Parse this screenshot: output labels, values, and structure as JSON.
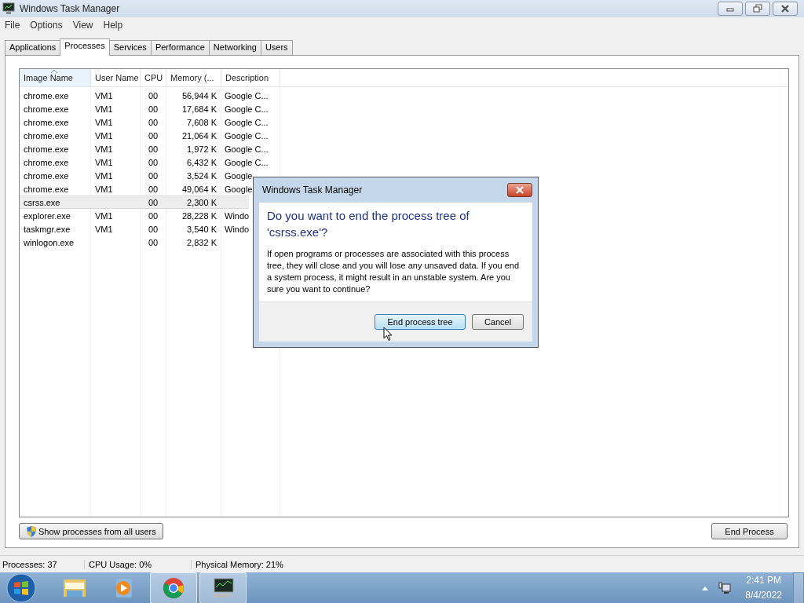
{
  "window": {
    "title": "Windows Task Manager"
  },
  "menu": [
    "File",
    "Options",
    "View",
    "Help"
  ],
  "tabs": [
    {
      "label": "Applications",
      "selected": false
    },
    {
      "label": "Processes",
      "selected": true
    },
    {
      "label": "Services",
      "selected": false
    },
    {
      "label": "Performance",
      "selected": false
    },
    {
      "label": "Networking",
      "selected": false
    },
    {
      "label": "Users",
      "selected": false
    }
  ],
  "table": {
    "columns": [
      {
        "label": "Image Name",
        "sorted": true
      },
      {
        "label": "User Name",
        "sorted": false
      },
      {
        "label": "CPU",
        "sorted": false
      },
      {
        "label": "Memory (...",
        "sorted": false
      },
      {
        "label": "Description",
        "sorted": false
      }
    ],
    "rows": [
      {
        "image_name": "chrome.exe",
        "user_name": "VM1",
        "cpu": "00",
        "memory": "56,944 K",
        "description": "Google C...",
        "selected": false
      },
      {
        "image_name": "chrome.exe",
        "user_name": "VM1",
        "cpu": "00",
        "memory": "17,684 K",
        "description": "Google C...",
        "selected": false
      },
      {
        "image_name": "chrome.exe",
        "user_name": "VM1",
        "cpu": "00",
        "memory": "7,608 K",
        "description": "Google C...",
        "selected": false
      },
      {
        "image_name": "chrome.exe",
        "user_name": "VM1",
        "cpu": "00",
        "memory": "21,064 K",
        "description": "Google C...",
        "selected": false
      },
      {
        "image_name": "chrome.exe",
        "user_name": "VM1",
        "cpu": "00",
        "memory": "1,972 K",
        "description": "Google C...",
        "selected": false
      },
      {
        "image_name": "chrome.exe",
        "user_name": "VM1",
        "cpu": "00",
        "memory": "6,432 K",
        "description": "Google C...",
        "selected": false
      },
      {
        "image_name": "chrome.exe",
        "user_name": "VM1",
        "cpu": "00",
        "memory": "3,524 K",
        "description": "Google",
        "selected": false
      },
      {
        "image_name": "chrome.exe",
        "user_name": "VM1",
        "cpu": "00",
        "memory": "49,064 K",
        "description": "Google",
        "selected": false
      },
      {
        "image_name": "csrss.exe",
        "user_name": "",
        "cpu": "00",
        "memory": "2,300 K",
        "description": "",
        "selected": true
      },
      {
        "image_name": "explorer.exe",
        "user_name": "VM1",
        "cpu": "00",
        "memory": "28,228 K",
        "description": "Windo",
        "selected": false
      },
      {
        "image_name": "taskmgr.exe",
        "user_name": "VM1",
        "cpu": "00",
        "memory": "3,540 K",
        "description": "Windo",
        "selected": false
      },
      {
        "image_name": "winlogon.exe",
        "user_name": "",
        "cpu": "00",
        "memory": "2,832 K",
        "description": "",
        "selected": false
      }
    ]
  },
  "show_all_button": "Show processes from all users",
  "end_process_button": "End Process",
  "status_bar": [
    "Processes: 37",
    "CPU Usage: 0%",
    "Physical Memory: 21%"
  ],
  "dialog": {
    "title": "Windows Task Manager",
    "heading": "Do you want to end the process tree of 'csrss.exe'?",
    "message": "If open programs or processes are associated with this process tree, they will close and you will lose any unsaved data. If you end a system process, it might result in an unstable system. Are you sure you want to continue?",
    "buttons": [
      {
        "label": "End process tree",
        "focused": true
      },
      {
        "label": "Cancel",
        "focused": false
      }
    ]
  },
  "taskbar": {
    "items": [
      {
        "kind": "explorer",
        "active": false
      },
      {
        "kind": "media",
        "active": false
      },
      {
        "kind": "chrome",
        "active": true
      },
      {
        "kind": "taskmgr",
        "active": true
      }
    ],
    "time": "2:41 PM",
    "date": "8/4/2022"
  }
}
